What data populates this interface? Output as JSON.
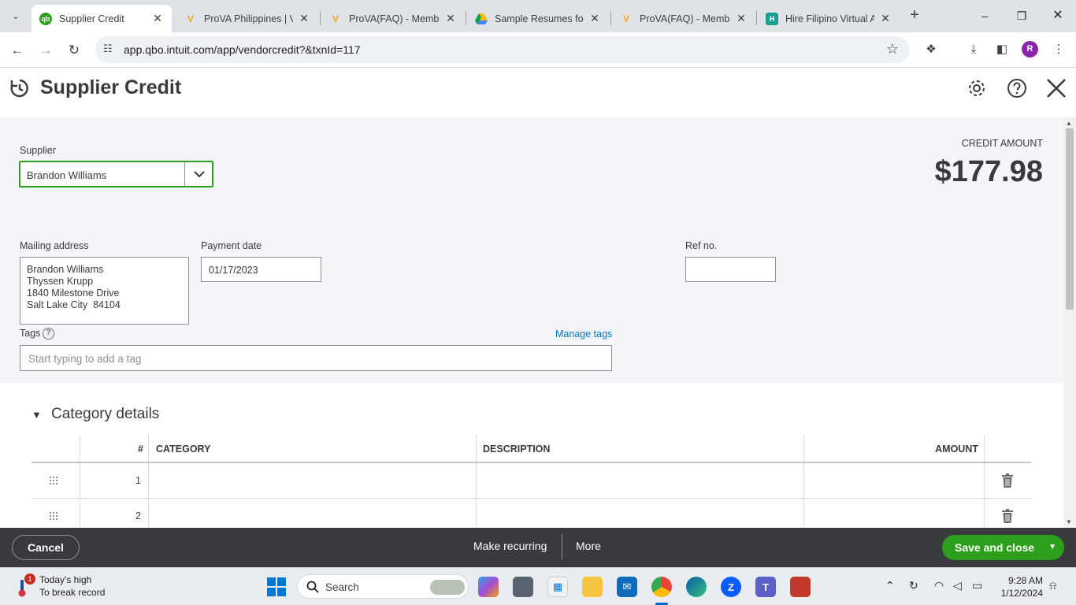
{
  "browser": {
    "tabs": [
      {
        "title": "Supplier Credit",
        "favicon": "quickbooks-icon",
        "active": true
      },
      {
        "title": "ProVA Philippines | Vi",
        "favicon": "prova-icon",
        "active": false
      },
      {
        "title": "ProVA(FAQ) - Membe",
        "favicon": "prova-icon",
        "active": false
      },
      {
        "title": "Sample Resumes for",
        "favicon": "google-drive-icon",
        "active": false
      },
      {
        "title": "ProVA(FAQ) - Membe",
        "favicon": "prova-icon",
        "active": false
      },
      {
        "title": "Hire Filipino Virtual A",
        "favicon": "hire-icon",
        "active": false
      }
    ],
    "url": "app.qbo.intuit.com/app/vendorcredit?&txnId=117",
    "profile_initial": "R"
  },
  "page": {
    "title": "Supplier Credit",
    "supplier": {
      "label": "Supplier",
      "value": "Brandon Williams"
    },
    "credit": {
      "label": "CREDIT AMOUNT",
      "amount": "$177.98"
    },
    "mailing_address": {
      "label": "Mailing address",
      "lines": [
        "Brandon Williams",
        "Thyssen Krupp",
        "1840 Milestone Drive",
        "Salt Lake City  84104"
      ]
    },
    "payment_date": {
      "label": "Payment date",
      "value": "01/17/2023"
    },
    "ref_no": {
      "label": "Ref no.",
      "value": ""
    },
    "tags": {
      "label": "Tags",
      "help": "?",
      "manage": "Manage tags",
      "placeholder": "Start typing to add a tag"
    },
    "category_details": {
      "title": "Category details",
      "columns": {
        "num": "#",
        "category": "CATEGORY",
        "description": "DESCRIPTION",
        "amount": "AMOUNT"
      },
      "rows": [
        {
          "num": "1",
          "category": "",
          "description": "",
          "amount": ""
        },
        {
          "num": "2",
          "category": "",
          "description": "",
          "amount": ""
        }
      ]
    }
  },
  "footer": {
    "cancel": "Cancel",
    "make_recurring": "Make recurring",
    "more": "More",
    "save_and_close": "Save and close"
  },
  "taskbar": {
    "weather_line1": "Today's high",
    "weather_line2": "To break record",
    "weather_badge": "1",
    "search_label": "Search",
    "time": "9:28 AM",
    "date": "1/12/2024"
  },
  "colors": {
    "brand_green": "#2ca01c",
    "link_blue": "#0077c5",
    "footer_bg": "#393a3d"
  }
}
